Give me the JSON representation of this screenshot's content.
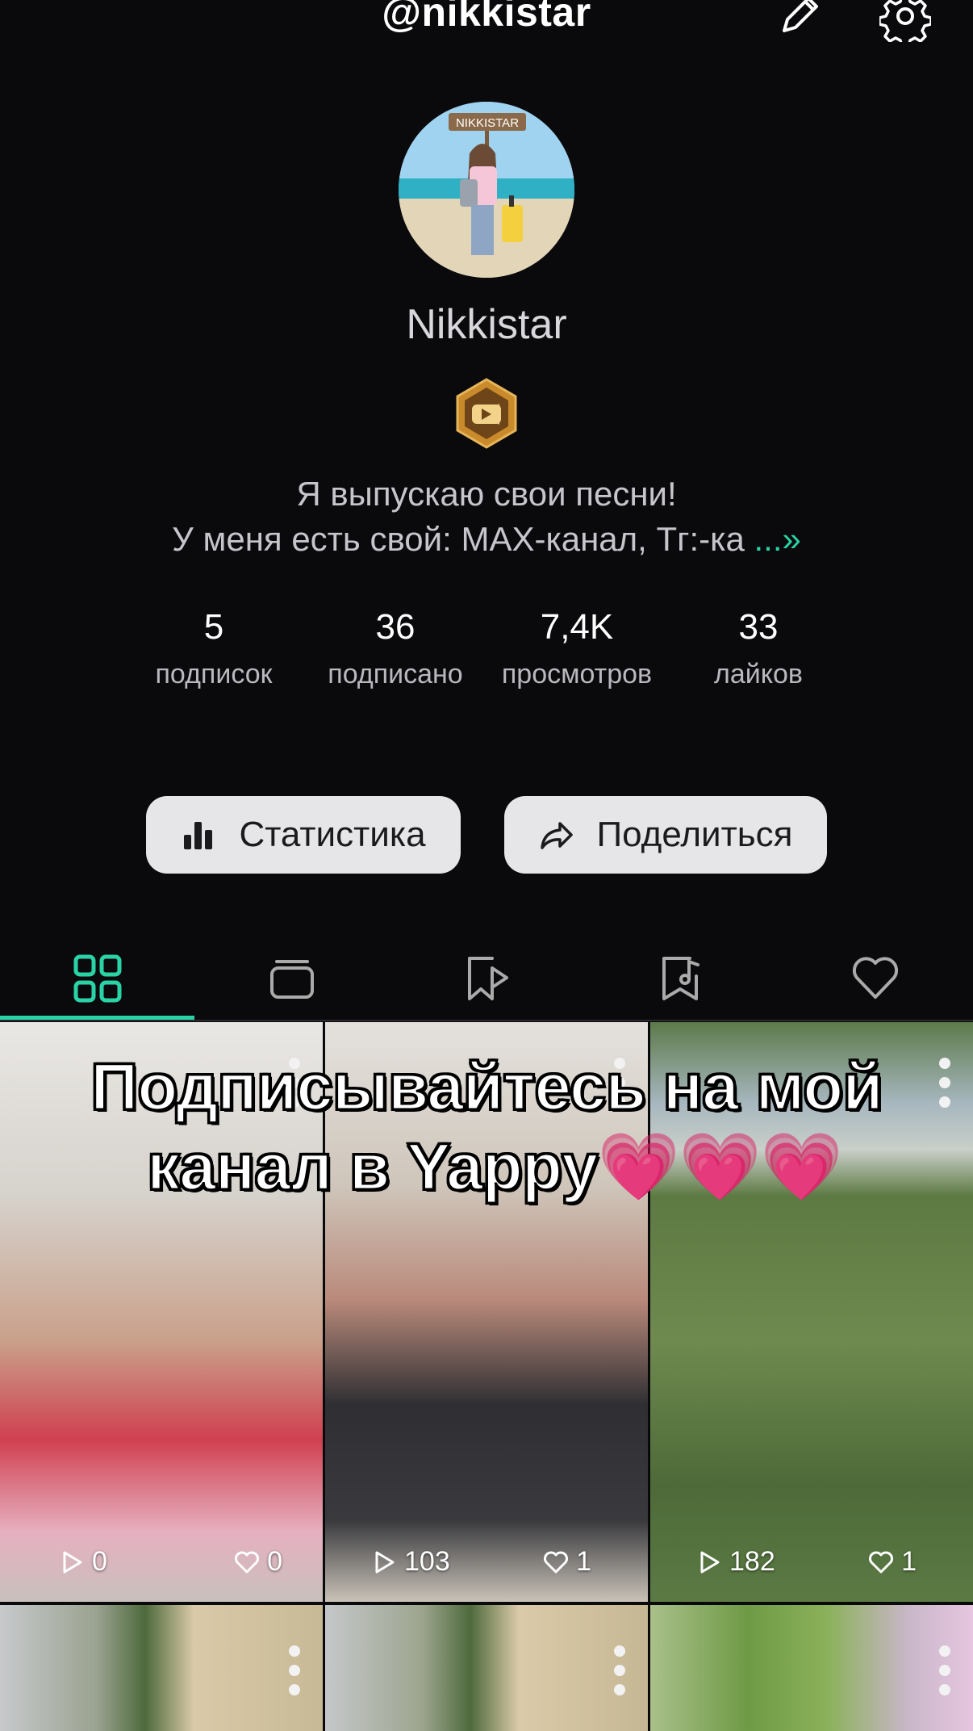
{
  "header": {
    "handle": "@nikkistar",
    "edit_icon": "pencil-icon",
    "settings_icon": "gear-icon"
  },
  "profile": {
    "display_name": "Nikkistar",
    "avatar_sign": "NIKKISTAR",
    "bio_line1": "Я выпускаю свои песни!",
    "bio_line2": "У меня есть свой: MAX-канал, Тг:-ка",
    "bio_more": "...»"
  },
  "stats": [
    {
      "value": "5",
      "label": "подписок"
    },
    {
      "value": "36",
      "label": "подписано"
    },
    {
      "value": "7,4K",
      "label": "просмотров"
    },
    {
      "value": "33",
      "label": "лайков"
    }
  ],
  "actions": {
    "stats_label": "Статистика",
    "share_label": "Поделиться"
  },
  "tabs": [
    "grid-icon",
    "playlist-icon",
    "bookmark-play-icon",
    "bookmark-music-icon",
    "heart-icon"
  ],
  "overlay": {
    "line1": "Подписывайтесь на мой",
    "line2": "канал в Yappy",
    "hearts": "💗💗💗"
  },
  "videos": [
    {
      "views": "0",
      "likes": "0"
    },
    {
      "views": "103",
      "likes": "1"
    },
    {
      "views": "182",
      "likes": "1"
    }
  ],
  "colors": {
    "accent": "#29d3a6",
    "background": "#0a0a0d",
    "button_bg": "#e6e6e8"
  }
}
